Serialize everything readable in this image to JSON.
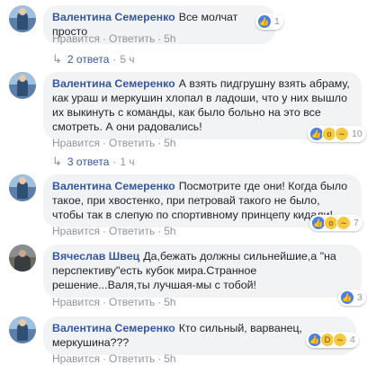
{
  "comments": [
    {
      "author": "Валентина Семеренко",
      "text": "Все молчат просто",
      "reactions": [
        "like-icon"
      ],
      "reaction_count": "1",
      "like": "Нравится",
      "reply": "Ответить",
      "time": "5h",
      "replies_label": "2 ответа",
      "replies_time": "5 ч"
    },
    {
      "author": "Валентина Семеренко",
      "text": "А взять пидгрушну взять абраму, как ураш и меркушин хлопал в ладоши, что у них вышло их выкинуть с команды, как было больно на это все смотреть. А они радовались!",
      "reactions": [
        "like-icon",
        "wow-icon",
        "sad-icon"
      ],
      "reaction_count": "10",
      "like": "Нравится",
      "reply": "Ответить",
      "time": "5h",
      "replies_label": "3 ответа",
      "replies_time": "1 ч"
    },
    {
      "author": "Валентина Семеренко",
      "text": "Посмотрите где они! Когда было такое, при хвостенко, при петровай такого не было, чтобы так в слепую по спортивному принцепу кидали!",
      "reactions": [
        "like-icon",
        "wow-icon",
        "sad-icon"
      ],
      "reaction_count": "7",
      "like": "Нравится",
      "reply": "Ответить",
      "time": "5h"
    },
    {
      "author": "Вячеслав Швец",
      "text": "Да,бежать должны сильнейшие,а \"на перспективу\"есть кубок мира.Странное решение...Валя,ты лучшая-мы с тобой!",
      "reactions": [
        "like-icon"
      ],
      "reaction_count": "3",
      "like": "Нравится",
      "reply": "Ответить",
      "time": "5h"
    },
    {
      "author": "Валентина Семеренко",
      "text": "Кто сильный, варванец, меркушина???",
      "reactions": [
        "like-icon",
        "laugh-icon",
        "sad-icon"
      ],
      "reaction_count": "4",
      "like": "Нравится",
      "reply": "Ответить",
      "time": "5h"
    }
  ]
}
